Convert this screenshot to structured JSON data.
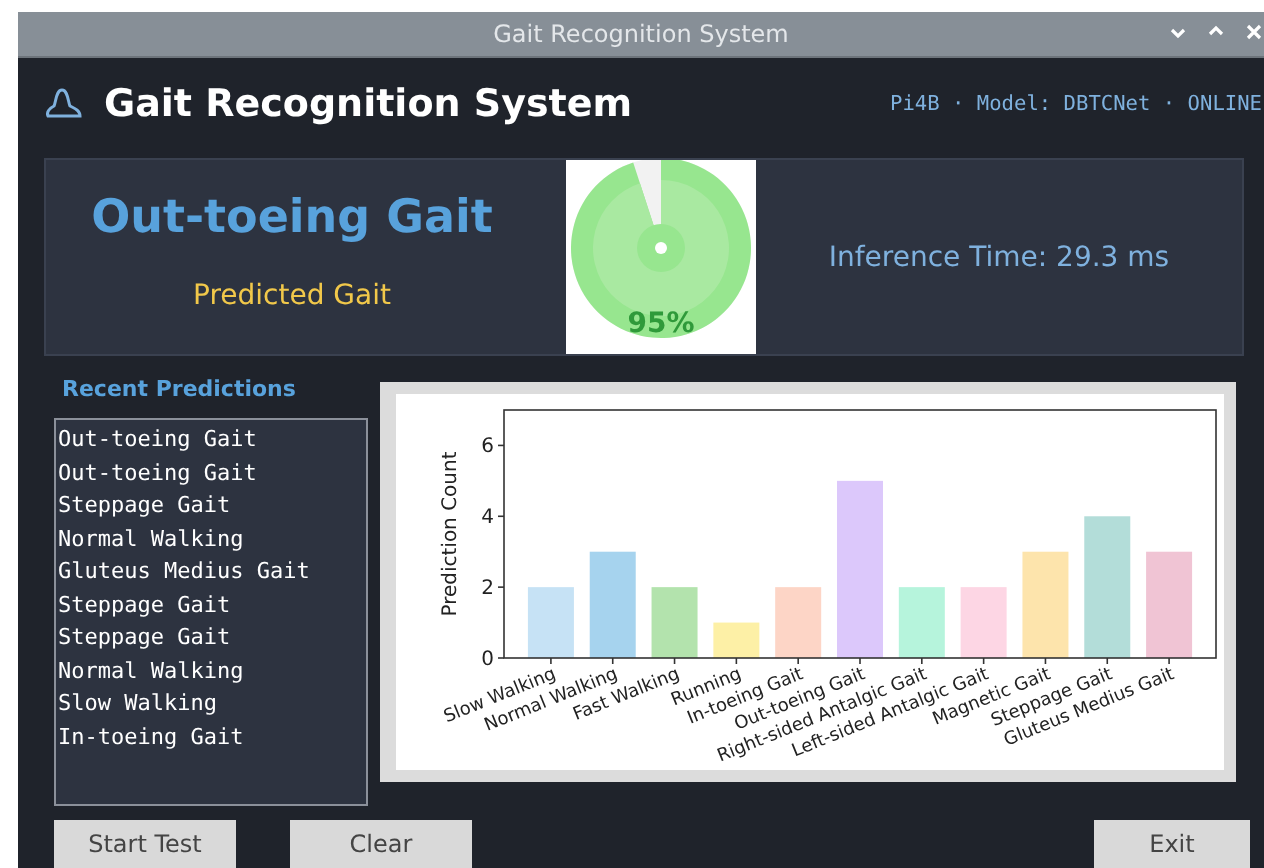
{
  "window": {
    "title": "Gait Recognition System"
  },
  "header": {
    "title": "Gait Recognition System",
    "status": "Pi4B · Model: DBTCNet · ONLINE"
  },
  "prediction": {
    "label": "Out-toeing Gait",
    "caption": "Predicted Gait",
    "confidence": {
      "reading": "95%"
    },
    "inference_time": "Inference Time: 29.3 ms"
  },
  "recent": {
    "title": "Recent Predictions",
    "items": [
      "Out-toeing Gait",
      "Out-toeing Gait",
      "Steppage Gait",
      "Normal Walking",
      "Gluteus Medius Gait",
      "Steppage Gait",
      "Steppage Gait",
      "Normal Walking",
      "Slow Walking",
      "In-toeing Gait"
    ]
  },
  "chart": {
    "bars": [
      {
        "color": "#c6e2f5"
      },
      {
        "color": "#a6d3ee"
      },
      {
        "color": "#b3e3ad"
      },
      {
        "color": "#fdf0a6"
      },
      {
        "color": "#fdd5c6"
      },
      {
        "color": "#dcc8fb"
      },
      {
        "color": "#b6f4dc"
      },
      {
        "color": "#fdd6e4"
      },
      {
        "color": "#fde4ac"
      },
      {
        "color": "#b3ddd9"
      },
      {
        "color": "#f0c4d4"
      }
    ],
    "chart_data": {
      "type": "bar",
      "ylabel": "Prediction Count",
      "categories": [
        "Slow Walking",
        "Normal Walking",
        "Fast Walking",
        "Running",
        "In-toeing Gait",
        "Out-toeing Gait",
        "Right-sided Antalgic Gait",
        "Left-sided Antalgic Gait",
        "Magnetic Gait",
        "Steppage Gait",
        "Gluteus Medius Gait"
      ],
      "series": [
        {
          "values": [
            2,
            3,
            2,
            1,
            2,
            5,
            2,
            2,
            3,
            4,
            3
          ]
        }
      ],
      "ylim": [
        0,
        7
      ],
      "yticks": [
        0,
        2,
        4,
        6
      ]
    }
  },
  "buttons": {
    "left": [
      "Start Test",
      "Clear"
    ],
    "right": [
      "Exit"
    ]
  }
}
